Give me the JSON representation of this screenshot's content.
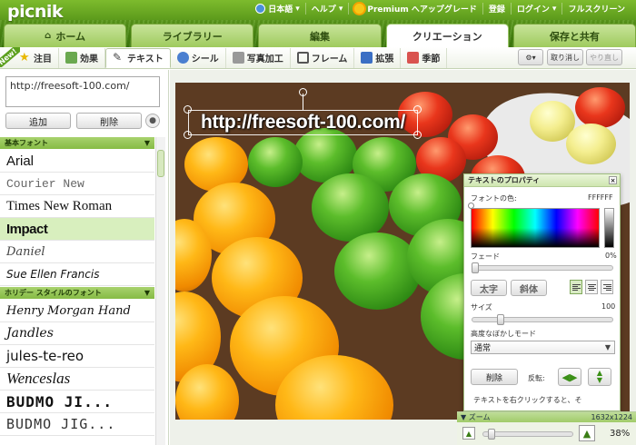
{
  "app": {
    "logo": "picnik"
  },
  "topnav": {
    "language": "日本語",
    "help": "ヘルプ",
    "premium": "Premium へアップグレード",
    "register": "登録",
    "login": "ログイン",
    "fullscreen": "フルスクリーン"
  },
  "tabs": {
    "home": "ホーム",
    "library": "ライブラリー",
    "edit": "編集",
    "create": "クリエーション",
    "save": "保存と共有"
  },
  "subtabs": {
    "new_badge": "New!",
    "featured": "注目",
    "effects": "効果",
    "text": "テキスト",
    "stickers": "シール",
    "touchup": "写真加工",
    "frames": "フレーム",
    "extend": "拡張",
    "seasons": "季節"
  },
  "toolbar": {
    "undo": "取り消し",
    "redo": "やり直し",
    "settings_arrow": "▾"
  },
  "left": {
    "input_value": "http://freesoft-100.com/",
    "add_label": "追加",
    "delete_label": "削除",
    "basic_fonts_header": "基本フォント",
    "holiday_header": "ホリデー スタイルのフォント",
    "fonts_basic": [
      "Arial",
      "Courier New",
      "Times New Roman",
      "Impact",
      "Daniel",
      "Sue Ellen Francis"
    ],
    "fonts_holiday": [
      "Henry Morgan Hand",
      "Jandles",
      "jules-te-reo",
      "Wenceslas",
      "BUDMO JI...",
      "BUDMO JIG..."
    ]
  },
  "canvas": {
    "overlay_text": "http://freesoft-100.com/"
  },
  "props": {
    "title": "テキストのプロパティ",
    "font_color_label": "フォントの色:",
    "font_color_value": "FFFFFF",
    "fade_label": "フェード",
    "fade_value": "0%",
    "bold_label": "太字",
    "italic_label": "斜体",
    "size_label": "サイズ",
    "size_value": "100",
    "blend_label": "高度なぼかしモード",
    "blend_value": "通常",
    "delete_label": "削除",
    "flip_label": "反転:",
    "hint": "テキストを右クリックすると、そ"
  },
  "zoom": {
    "label": "ズーム",
    "dimensions": "1632x1224",
    "value": "38%"
  },
  "colors": {
    "accent": "#7dbb2d",
    "header": "#4e8d14"
  }
}
